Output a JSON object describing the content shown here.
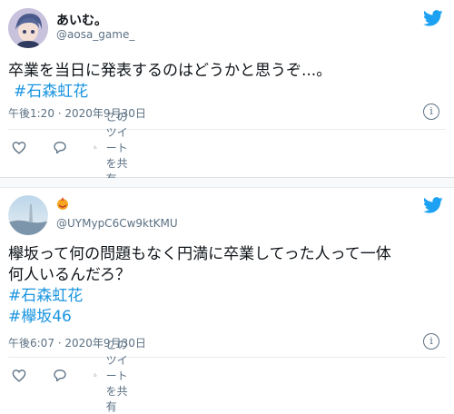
{
  "tweets": [
    {
      "display_name": "あいむ。",
      "handle": "@aosa_game_",
      "text": "卒業を当日に発表するのはどうかと思うぞ...。",
      "hashtags": [
        "#石森虹花"
      ],
      "timestamp": "午後1:20 · 2020年9月30日",
      "share_label": "このツイートを共有"
    },
    {
      "display_name": "",
      "handle": "@UYMypC6Cw9ktKMU",
      "text_line1": "欅坂って何の問題もなく円満に卒業してった人って一体",
      "text_line2": "何人いるんだろ？",
      "hashtags": [
        "#石森虹花",
        "#欅坂46"
      ],
      "timestamp": "午後6:07 · 2020年9月30日",
      "share_label": "このツイートを共有"
    }
  ],
  "icons": {
    "brand": "twitter-bird-icon",
    "info": "info-icon",
    "like": "heart-icon",
    "reply": "reply-bubble-icon",
    "share": "share-icon",
    "badge": "flame-badge-icon"
  },
  "colors": {
    "twitter_blue": "#1da1f2",
    "hashtag": "#1b95e0",
    "muted": "#5b7083"
  }
}
